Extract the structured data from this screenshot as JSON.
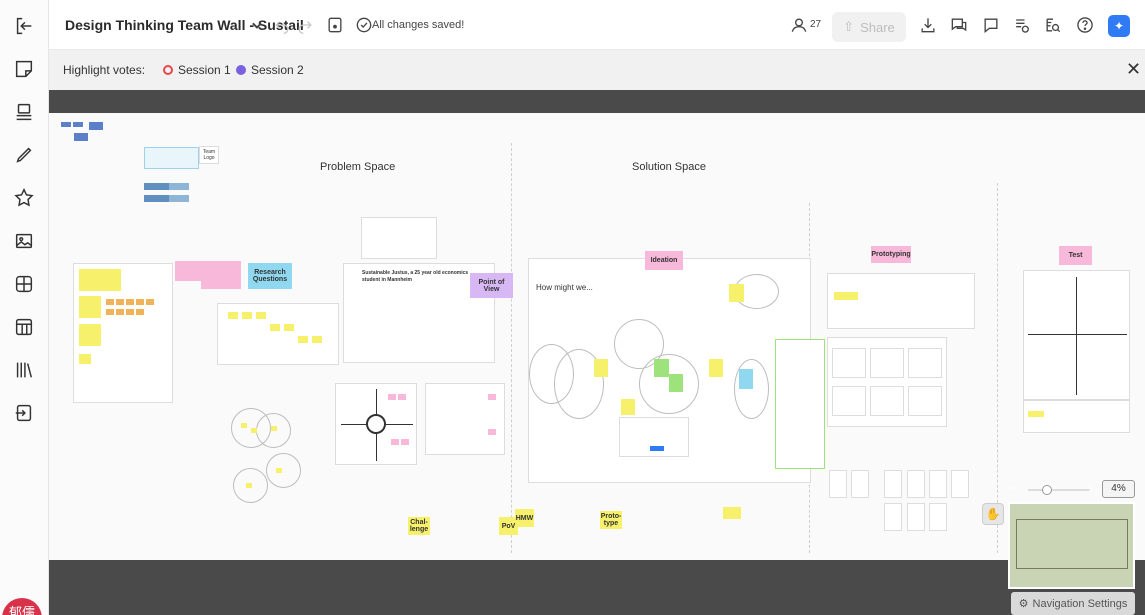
{
  "header": {
    "board_title": "Design Thinking Team Wall - Sustail",
    "saved_status": "All changes saved!",
    "user_count": "27",
    "share_label": "Share"
  },
  "highlight_votes": {
    "label": "Highlight votes:",
    "sessions": [
      {
        "label": "Session 1",
        "color": "#e5484d"
      },
      {
        "label": "Session 2",
        "color": "#7b61e0"
      }
    ]
  },
  "canvas": {
    "regions": {
      "problem_space": "Problem Space",
      "solution_space": "Solution Space"
    },
    "phase_tags": {
      "ideation": "Ideation",
      "prototyping": "Prototyping",
      "test": "Test",
      "research_questions": "Research Questions",
      "point_of_view": "Point of View"
    },
    "team_logo": "Team Logo",
    "persona_title": "Sustainable Justus, a 25 year old economics student in Mannheim",
    "how_might_we": "How might we...",
    "flow_labels": [
      "Chal-lenge",
      "PoV",
      "HMW",
      "Proto-type"
    ]
  },
  "zoom": {
    "level": "4%",
    "minus": "−",
    "plus": "+"
  },
  "navigation_settings": "Navigation Settings",
  "avatar_initials": "郁儒",
  "colors": {
    "accent": "#2f7bf5",
    "sticky_yellow": "#f7f06a",
    "tag_pink": "#f7b8d9",
    "tag_cyan": "#8fd8f0",
    "tag_violet": "#d7b8f5",
    "minimap": "#c9d4b5"
  }
}
